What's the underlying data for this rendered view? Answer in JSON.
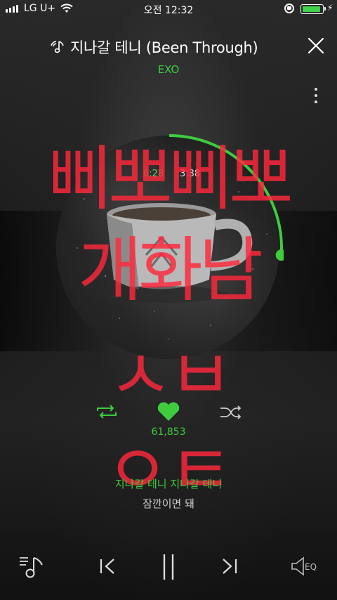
{
  "status_bar": {
    "carrier": "LG U+",
    "time": "오전 12:32",
    "battery_level": 0.95
  },
  "header": {
    "title": "지나갈 테니 (Been Through)",
    "artist": "EXO"
  },
  "player": {
    "elapsed": "0:28",
    "total": "3:38",
    "progress": 0.26,
    "like_count": "61,853"
  },
  "overlay": {
    "line1": "삐뽀삐뽀",
    "line2": "개화남",
    "line3": "ㅅㅂ",
    "line4": "ㅇㅌ"
  },
  "lyrics": {
    "current": "지나갈 테니 지나갈 테니",
    "next": "잠깐이면 돼"
  },
  "bottom_bar": {
    "eq_label": "EQ"
  },
  "colors": {
    "accent": "#3ecc3e",
    "overlay": "#ff283c"
  },
  "icons": [
    "signal-icon",
    "wifi-icon",
    "rotation-lock-icon",
    "battery-icon",
    "music-note-icon",
    "close-icon",
    "more-icon",
    "repeat-icon",
    "heart-icon",
    "shuffle-icon",
    "playlist-icon",
    "previous-icon",
    "pause-icon",
    "next-icon",
    "equalizer-icon"
  ]
}
